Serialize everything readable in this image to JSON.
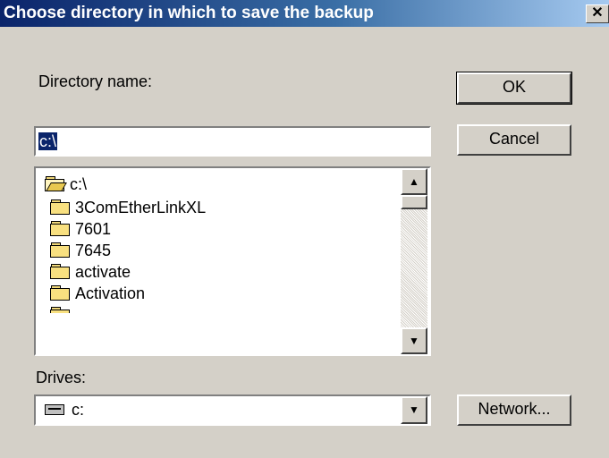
{
  "window": {
    "title": "Choose directory in which to save the backup",
    "close_glyph": "✕"
  },
  "directory": {
    "label": "Directory name:",
    "value": "c:\\"
  },
  "buttons": {
    "ok": "OK",
    "cancel": "Cancel",
    "network": "Network..."
  },
  "dir_list": {
    "items": [
      {
        "name": "c:\\",
        "icon": "open-folder-icon"
      },
      {
        "name": "3ComEtherLinkXL",
        "icon": "folder-icon"
      },
      {
        "name": "7601",
        "icon": "folder-icon"
      },
      {
        "name": "7645",
        "icon": "folder-icon"
      },
      {
        "name": "activate",
        "icon": "folder-icon"
      },
      {
        "name": "Activation",
        "icon": "folder-icon"
      }
    ]
  },
  "drives": {
    "label": "Drives:",
    "selected": "c:",
    "icon": "drive-icon"
  },
  "colors": {
    "titlebar_start": "#0a246a",
    "titlebar_end": "#a6caf0",
    "dialog_bg": "#d4d0c8",
    "selection": "#0a246a"
  }
}
